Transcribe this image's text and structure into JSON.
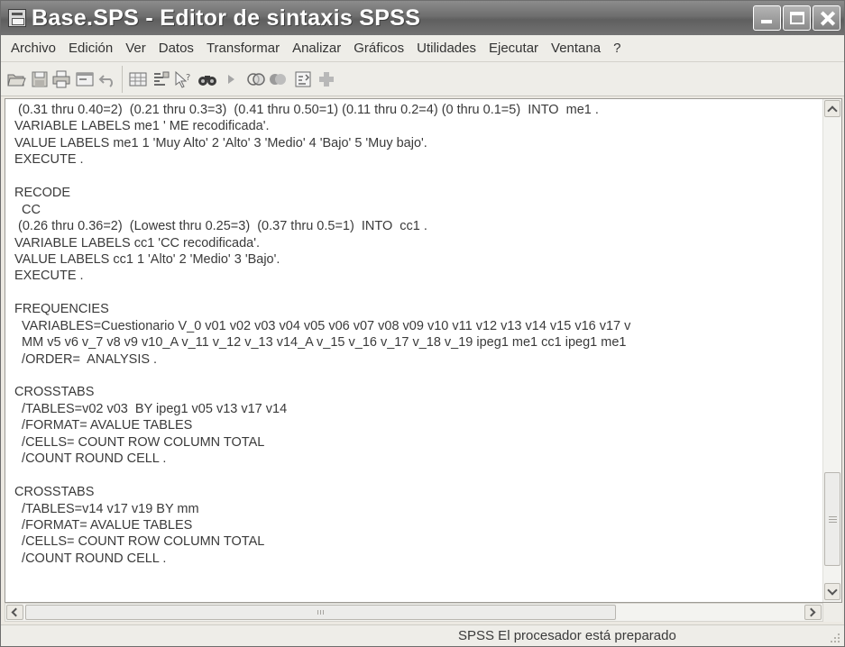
{
  "window": {
    "title": "Base.SPS - Editor de sintaxis SPSS",
    "icon": "spss-syntax-icon",
    "controls": [
      "minimize-icon",
      "maximize-icon",
      "close-icon"
    ]
  },
  "menu": {
    "items": [
      "Archivo",
      "Edición",
      "Ver",
      "Datos",
      "Transformar",
      "Analizar",
      "Gráficos",
      "Utilidades",
      "Ejecutar",
      "Ventana",
      "?"
    ]
  },
  "toolbar": {
    "icons": [
      "open-folder-icon",
      "save-icon",
      "print-icon",
      "dialog-recall-icon",
      "undo-icon",
      "goto-data-icon",
      "variables-icon",
      "help-cursor-icon",
      "find-icon",
      "run-icon",
      "use-sets-icon",
      "show-all-icon",
      "syntax-help-icon",
      "add-icon"
    ]
  },
  "editor": {
    "lines": [
      " (0.31 thru 0.40=2)  (0.21 thru 0.3=3)  (0.41 thru 0.50=1) (0.11 thru 0.2=4) (0 thru 0.1=5)  INTO  me1 .",
      "VARIABLE LABELS me1 ' ME recodificada'.",
      "VALUE LABELS me1 1 'Muy Alto' 2 'Alto' 3 'Medio' 4 'Bajo' 5 'Muy bajo'.",
      "EXECUTE .",
      "",
      "RECODE",
      "  CC",
      " (0.26 thru 0.36=2)  (Lowest thru 0.25=3)  (0.37 thru 0.5=1)  INTO  cc1 .",
      "VARIABLE LABELS cc1 'CC recodificada'.",
      "VALUE LABELS cc1 1 'Alto' 2 'Medio' 3 'Bajo'.",
      "EXECUTE .",
      "",
      "FREQUENCIES",
      "  VARIABLES=Cuestionario V_0 v01 v02 v03 v04 v05 v06 v07 v08 v09 v10 v11 v12 v13 v14 v15 v16 v17 v",
      "  MM v5 v6 v_7 v8 v9 v10_A v_11 v_12 v_13 v14_A v_15 v_16 v_17 v_18 v_19 ipeg1 me1 cc1 ipeg1 me1",
      "  /ORDER=  ANALYSIS .",
      "",
      "CROSSTABS",
      "  /TABLES=v02 v03  BY ipeg1 v05 v13 v17 v14",
      "  /FORMAT= AVALUE TABLES",
      "  /CELLS= COUNT ROW COLUMN TOTAL",
      "  /COUNT ROUND CELL .",
      "",
      "CROSSTABS",
      "  /TABLES=v14 v17 v19 BY mm",
      "  /FORMAT= AVALUE TABLES",
      "  /CELLS= COUNT ROW COLUMN TOTAL",
      "  /COUNT ROUND CELL ."
    ]
  },
  "status": {
    "text": "SPSS El procesador  está preparado"
  }
}
